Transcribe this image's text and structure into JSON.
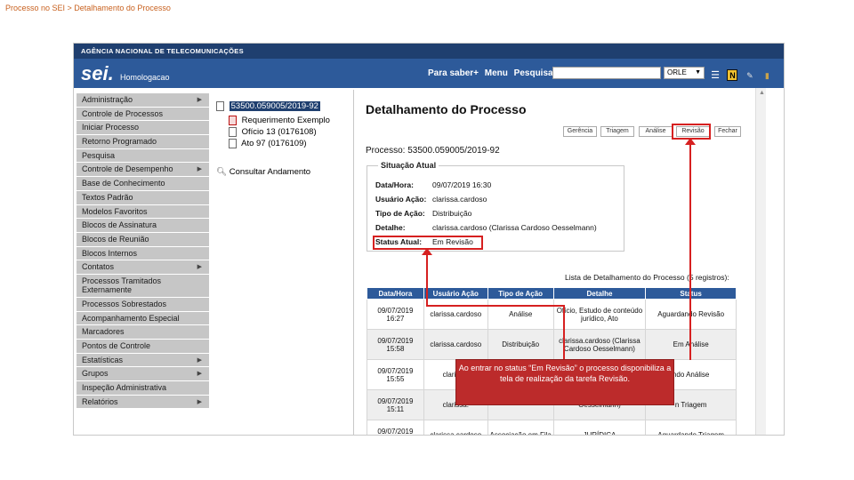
{
  "slide": {
    "title": "Processo no SEI > Detalhamento do Processo"
  },
  "header": {
    "agency": "AGÊNCIA NACIONAL DE TELECOMUNICAÇÕES",
    "logo": "sei.",
    "environment": "Homologacao",
    "links": [
      "Para saber+",
      "Menu",
      "Pesquisa"
    ],
    "search_value": "",
    "unit": "ORLE",
    "icons": [
      "list-icon",
      "notice-icon",
      "tools-icon",
      "exit-icon"
    ]
  },
  "sidebar": {
    "items": [
      {
        "label": "Administração",
        "arrow": true
      },
      {
        "label": "Controle de Processos",
        "arrow": false
      },
      {
        "label": "Iniciar Processo",
        "arrow": false
      },
      {
        "label": "Retorno Programado",
        "arrow": false
      },
      {
        "label": "Pesquisa",
        "arrow": false
      },
      {
        "label": "Controle de Desempenho",
        "arrow": true
      },
      {
        "label": "Base de Conhecimento",
        "arrow": false
      },
      {
        "label": "Textos Padrão",
        "arrow": false
      },
      {
        "label": "Modelos Favoritos",
        "arrow": false
      },
      {
        "label": "Blocos de Assinatura",
        "arrow": false
      },
      {
        "label": "Blocos de Reunião",
        "arrow": false
      },
      {
        "label": "Blocos Internos",
        "arrow": false
      },
      {
        "label": "Contatos",
        "arrow": true
      },
      {
        "label": "Processos Tramitados Externamente",
        "arrow": false,
        "tall": true
      },
      {
        "label": "Processos Sobrestados",
        "arrow": false
      },
      {
        "label": "Acompanhamento Especial",
        "arrow": false
      },
      {
        "label": "Marcadores",
        "arrow": false
      },
      {
        "label": "Pontos de Controle",
        "arrow": false
      },
      {
        "label": "Estatísticas",
        "arrow": true
      },
      {
        "label": "Grupos",
        "arrow": true
      },
      {
        "label": "Inspeção Administrativa",
        "arrow": false
      },
      {
        "label": "Relatórios",
        "arrow": true
      }
    ]
  },
  "tree": {
    "process_number": "53500.059005/2019-92",
    "documents": [
      "Requerimento Exemplo",
      "Ofício 13 (0176108)",
      "Ato 97 (0176109)"
    ],
    "consult": "Consultar Andamento"
  },
  "main": {
    "title": "Detalhamento do Processo",
    "actions": [
      "Gerência",
      "Triagem",
      "Análise",
      "Revisão",
      "Fechar"
    ],
    "process_label": "Processo: 53500.059005/2019-92",
    "situation_legend": "Situação Atual",
    "situation": [
      {
        "key": "Data/Hora:",
        "value": "09/07/2019 16:30"
      },
      {
        "key": "Usuário Ação:",
        "value": "clarissa.cardoso"
      },
      {
        "key": "Tipo de Ação:",
        "value": "Distribuição"
      },
      {
        "key": "Detalhe:",
        "value": "clarissa.cardoso (Clarissa Cardoso Oesselmann)"
      },
      {
        "key": "Status Atual:",
        "value": "Em Revisão"
      }
    ],
    "list_caption": "Lista de Detalhamento do Processo (5 registros):",
    "table": {
      "headers": [
        "Data/Hora",
        "Usuário Ação",
        "Tipo de Ação",
        "Detalhe",
        "Status"
      ],
      "rows": [
        [
          "09/07/2019 16:27",
          "clarissa.cardoso",
          "Análise",
          "Ofício, Estudo de conteúdo jurídico, Ato",
          "Aguardando Revisão"
        ],
        [
          "09/07/2019 15:58",
          "clarissa.cardoso",
          "Distribuição",
          "clarissa.cardoso (Clarissa Cardoso Oesselmann)",
          "Em Análise"
        ],
        [
          "09/07/2019 15:55",
          "clarissa.",
          "",
          "",
          "ndo Análise"
        ],
        [
          "09/07/2019 15:11",
          "clarissa.",
          "",
          "Oesselmann)",
          "n Triagem"
        ],
        [
          "09/07/2019 15:03",
          "clarissa.cardoso",
          "Associação em Fila",
          "JURÍDICA",
          "Aguardando Triagem"
        ]
      ]
    }
  },
  "callout": {
    "text": "Ao entrar no status “Em Revisão” o processo disponibiliza a tela de realização da tarefa Revisão."
  },
  "colors": {
    "header": "#2d5a9a",
    "agency_bar": "#1f3f6f",
    "highlight": "#d62020",
    "callout": "#bc2b2b",
    "slide_title": "#c8611f"
  }
}
